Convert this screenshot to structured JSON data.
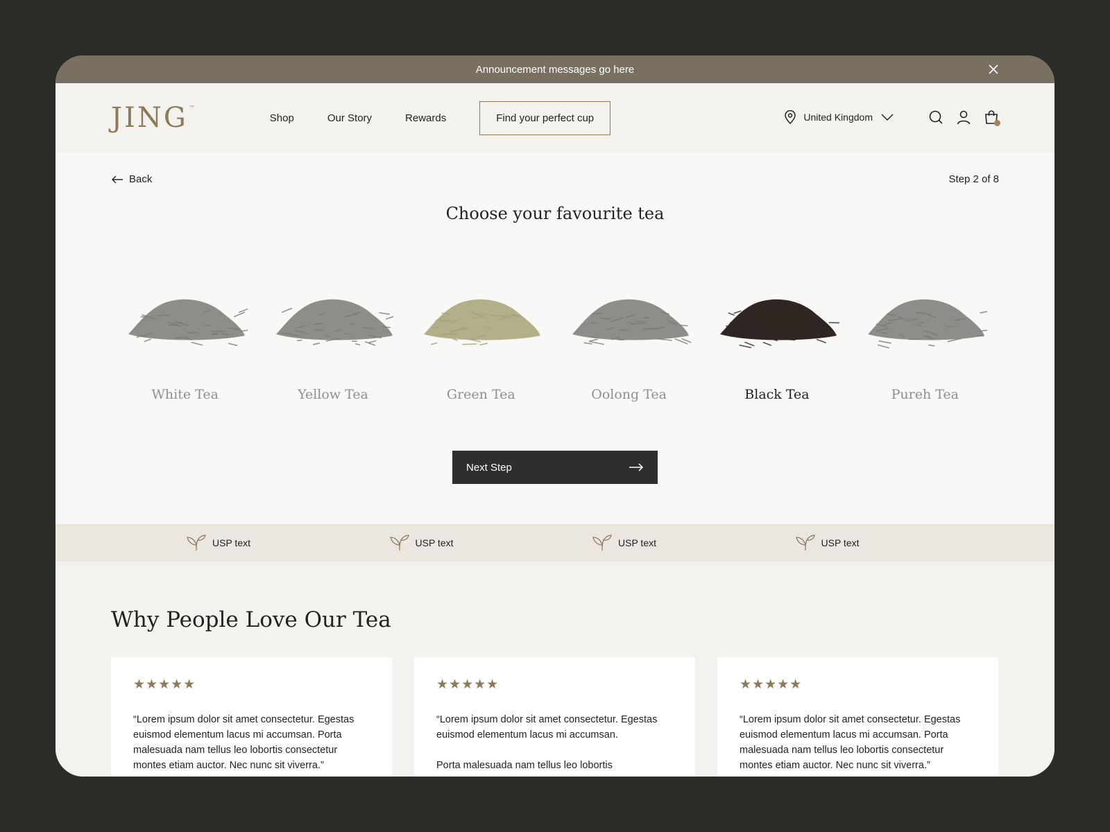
{
  "announcement": {
    "text": "Announcement messages go here"
  },
  "header": {
    "logo": "JING",
    "logo_mark": "™",
    "nav": [
      {
        "label": "Shop"
      },
      {
        "label": "Our Story"
      },
      {
        "label": "Rewards"
      }
    ],
    "cta": "Find your perfect cup",
    "country": "United Kingdom"
  },
  "quiz": {
    "back": "Back",
    "step": "Step 2 of 8",
    "title": "Choose your favourite tea",
    "teas": [
      {
        "name": "White Tea",
        "selected": false,
        "color": "#7d7a76"
      },
      {
        "name": "Yellow Tea",
        "selected": false,
        "color": "#7d7a76"
      },
      {
        "name": "Green Tea",
        "selected": false,
        "color": "#a6a276"
      },
      {
        "name": "Oolong Tea",
        "selected": false,
        "color": "#7d7a76"
      },
      {
        "name": "Black Tea",
        "selected": true,
        "color": "#2f2622"
      },
      {
        "name": "Pureh Tea",
        "selected": false,
        "color": "#7d7a76"
      }
    ],
    "next": "Next Step"
  },
  "usps": [
    {
      "text": "USP text"
    },
    {
      "text": "USP text"
    },
    {
      "text": "USP text"
    },
    {
      "text": "USP text"
    }
  ],
  "reviews": {
    "heading": "Why People Love Our Tea",
    "cards": [
      {
        "stars": "★★★★★",
        "p1": "“Lorem ipsum dolor sit amet consectetur. Egestas euismod elementum lacus mi accumsan. Porta malesuada nam tellus leo lobortis consectetur montes etiam auctor. Nec nunc sit viverra.”",
        "p2": ""
      },
      {
        "stars": "★★★★★",
        "p1": "“Lorem ipsum dolor sit amet consectetur. Egestas euismod elementum lacus mi accumsan.",
        "p2": "Porta malesuada nam tellus leo lobortis"
      },
      {
        "stars": "★★★★★",
        "p1": "“Lorem ipsum dolor sit amet consectetur. Egestas euismod elementum lacus mi accumsan. Porta malesuada nam tellus leo lobortis consectetur montes etiam auctor. Nec nunc sit viverra.”",
        "p2": ""
      }
    ]
  },
  "colors": {
    "accent": "#8b7b5a",
    "announcement_bg": "#7a7061",
    "frame_bg": "#2c2c27",
    "button_dark": "#2e2e2e",
    "usp_bar_bg": "#ebe6df"
  }
}
